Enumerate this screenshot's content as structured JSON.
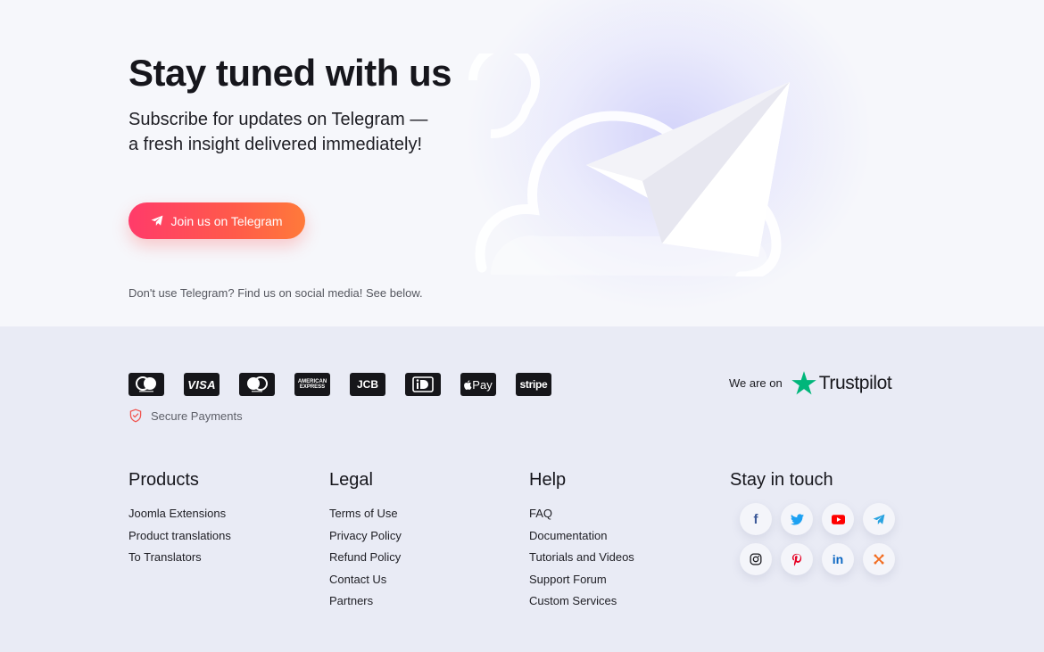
{
  "hero": {
    "title": "Stay tuned with us",
    "subtitle_line1": "Subscribe for updates on Telegram —",
    "subtitle_line2": "a fresh insight delivered immediately!",
    "button_label": "Join us on Telegram",
    "note": "Don't use Telegram? Find us on social media! See below."
  },
  "payments": {
    "methods": [
      {
        "name": "mastercard",
        "icon": "mastercard-icon"
      },
      {
        "name": "visa",
        "label": "VISA",
        "icon": "visa-icon"
      },
      {
        "name": "maestro",
        "icon": "maestro-icon"
      },
      {
        "name": "american-express",
        "label_line1": "AMERICAN",
        "label_line2": "EXPRESS",
        "icon": "amex-icon"
      },
      {
        "name": "jcb",
        "label": "JCB",
        "icon": "jcb-icon"
      },
      {
        "name": "ideal",
        "icon": "ideal-icon"
      },
      {
        "name": "apple-pay",
        "label": "Pay",
        "icon": "apple-pay-icon"
      },
      {
        "name": "stripe",
        "label": "stripe",
        "icon": "stripe-icon"
      }
    ],
    "secure_label": "Secure Payments"
  },
  "trustpilot": {
    "prefix": "We are on",
    "brand": "Trustpilot",
    "star_color": "#00b67a"
  },
  "columns": [
    {
      "title": "Products",
      "items": [
        "Joomla Extensions",
        "Product translations",
        "To Translators"
      ]
    },
    {
      "title": "Legal",
      "items": [
        "Terms of Use",
        "Privacy Policy",
        "Refund Policy",
        "Contact Us",
        "Partners"
      ]
    },
    {
      "title": "Help",
      "items": [
        "FAQ",
        "Documentation",
        "Tutorials and Videos",
        "Support Forum",
        "Custom Services"
      ]
    },
    {
      "title": "Stay in touch",
      "items": []
    }
  ],
  "social": [
    {
      "name": "facebook",
      "icon": "facebook-icon",
      "color": "#3b5998",
      "glyph": "f"
    },
    {
      "name": "twitter",
      "icon": "twitter-icon",
      "color": "#1da1f2"
    },
    {
      "name": "youtube",
      "icon": "youtube-icon",
      "color": "#ff0000"
    },
    {
      "name": "telegram",
      "icon": "telegram-icon",
      "color": "#2aa3e0"
    },
    {
      "name": "instagram",
      "icon": "instagram-icon",
      "color": "#1a1a1f"
    },
    {
      "name": "pinterest",
      "icon": "pinterest-icon",
      "color": "#e60023"
    },
    {
      "name": "linkedin",
      "icon": "linkedin-icon",
      "color": "#0a66c2",
      "glyph": "in"
    },
    {
      "name": "joomla",
      "icon": "joomla-icon",
      "color": "#f26d21"
    }
  ],
  "colors": {
    "button_gradient_start": "#ff3b6a",
    "button_gradient_end": "#ff7a3a",
    "hero_bg": "#f6f7fb",
    "footer_bg": "#e9ebf5",
    "secure_icon": "#f0544f"
  }
}
